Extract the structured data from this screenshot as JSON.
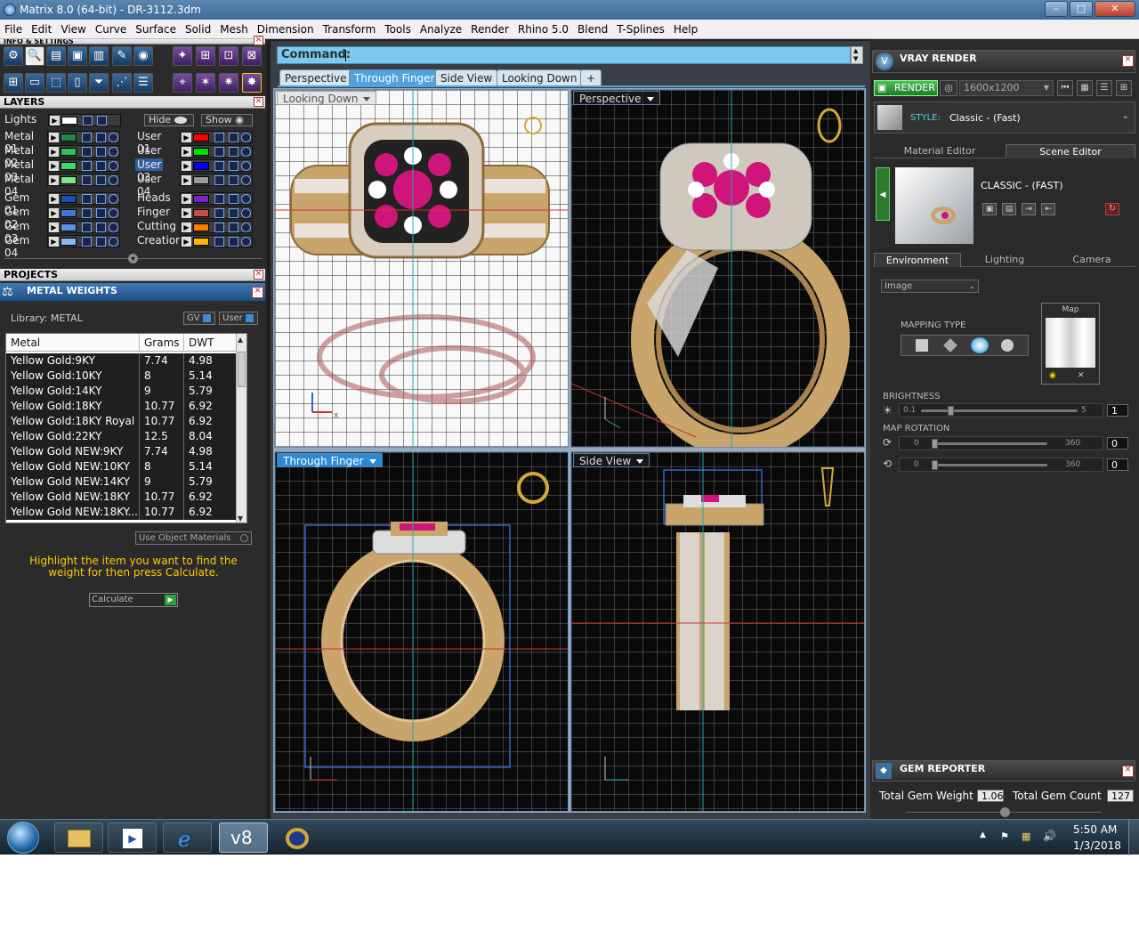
{
  "window": {
    "title": "Matrix 8.0 (64-bit) - DR-3112.3dm",
    "min": "–",
    "max": "□",
    "close": "✕"
  },
  "menu": [
    "File",
    "Edit",
    "View",
    "Curve",
    "Surface",
    "Solid",
    "Mesh",
    "Dimension",
    "Transform",
    "Tools",
    "Analyze",
    "Render",
    "Rhino 5.0",
    "Blend",
    "T-Splines",
    "Help"
  ],
  "left": {
    "info_header": "INFO & SETTINGS",
    "layers_header": "LAYERS",
    "lights_label": "Lights",
    "hide_label": "Hide",
    "show_label": "Show",
    "layers_left": [
      {
        "name": "Metal 01",
        "color": "#1e8a4a"
      },
      {
        "name": "Metal 02",
        "color": "#2fbf5f"
      },
      {
        "name": "Metal 03",
        "color": "#3fd66e"
      },
      {
        "name": "Metal 04",
        "color": "#7ae88a"
      },
      {
        "name": "Gem 01",
        "color": "#1f4fae"
      },
      {
        "name": "Gem 02",
        "color": "#3c78d8"
      },
      {
        "name": "Gem 03",
        "color": "#5a95e6"
      },
      {
        "name": "Gem 04",
        "color": "#8cb8f0"
      }
    ],
    "layers_right": [
      {
        "name": "User 01",
        "color": "#ff0000"
      },
      {
        "name": "User 02",
        "color": "#00e000"
      },
      {
        "name": "User 03",
        "color": "#0000ff"
      },
      {
        "name": "User 04",
        "color": "#9a9a9a"
      },
      {
        "name": "Heads",
        "color": "#7a22c8"
      },
      {
        "name": "Finger",
        "color": "#c84a4a"
      },
      {
        "name": "Cutting",
        "color": "#ff7a00"
      },
      {
        "name": "Creation",
        "color": "#ffb400"
      }
    ],
    "projects_header": "PROJECTS",
    "metal_weights_title": "METAL WEIGHTS",
    "library_label": "Library: METAL",
    "gv_label": "GV",
    "user_label": "User",
    "table_headers": [
      "Metal",
      "Grams",
      "DWT"
    ],
    "table_rows": [
      [
        "Yellow Gold:9KY",
        "7.74",
        "4.98"
      ],
      [
        "Yellow Gold:10KY",
        "8",
        "5.14"
      ],
      [
        "Yellow Gold:14KY",
        "9",
        "5.79"
      ],
      [
        "Yellow Gold:18KY",
        "10.77",
        "6.92"
      ],
      [
        "Yellow Gold:18KY Royal",
        "10.77",
        "6.92"
      ],
      [
        "Yellow Gold:22KY",
        "12.5",
        "8.04"
      ],
      [
        "Yellow Gold NEW:9KY",
        "7.74",
        "4.98"
      ],
      [
        "Yellow Gold NEW:10KY",
        "8",
        "5.14"
      ],
      [
        "Yellow Gold NEW:14KY",
        "9",
        "5.79"
      ],
      [
        "Yellow Gold NEW:18KY",
        "10.77",
        "6.92"
      ],
      [
        "Yellow Gold NEW:18KY...",
        "10.77",
        "6.92"
      ]
    ],
    "use_object_materials": "Use Object Materials",
    "hint": "Highlight the item you want to find the weight for then press Calculate.",
    "calculate_label": "Calculate"
  },
  "center": {
    "command_label": "Command:",
    "tabs": [
      "Perspective",
      "Through Finger",
      "Side View",
      "Looking Down"
    ],
    "active_tab": "Through Finger",
    "add_tab": "+",
    "viewports": [
      "Looking Down",
      "Perspective",
      "Through Finger",
      "Side View"
    ],
    "active_viewport": "Through Finger"
  },
  "right": {
    "vray_title": "VRAY RENDER",
    "render_label": "RENDER",
    "resolution": "1600x1200",
    "style_label": "STYLE:",
    "style_value": "Classic - (Fast)",
    "tab_material_editor": "Material Editor",
    "tab_scene_editor": "Scene Editor",
    "scene_name": "CLASSIC - (FAST)",
    "tab_environment": "Environment",
    "tab_lighting": "Lighting",
    "tab_camera": "Camera",
    "env_mode": "Image",
    "mapping_type_label": "MAPPING TYPE",
    "map_label": "Map",
    "brightness_label": "BRIGHTNESS",
    "brightness_min": "0.1",
    "brightness_max": "5",
    "brightness_value": "1",
    "map_rotation_label": "MAP ROTATION",
    "rot1_min": "0",
    "rot1_max": "360",
    "rot1_value": "0",
    "rot2_min": "0",
    "rot2_max": "360",
    "rot2_value": "0",
    "gem_reporter_title": "GEM REPORTER",
    "total_gem_weight_label": "Total Gem Weight",
    "total_gem_weight": "1.06",
    "total_gem_count_label": "Total Gem Count",
    "total_gem_count": "127"
  },
  "taskbar": {
    "time": "5:50 AM",
    "date": "1/3/2018",
    "v8_label": "v8"
  },
  "colors": {
    "accent": "#2b8ad6",
    "hint_yellow": "#ffcc00",
    "gold": "#c9a46b",
    "ruby": "#d0157a"
  }
}
